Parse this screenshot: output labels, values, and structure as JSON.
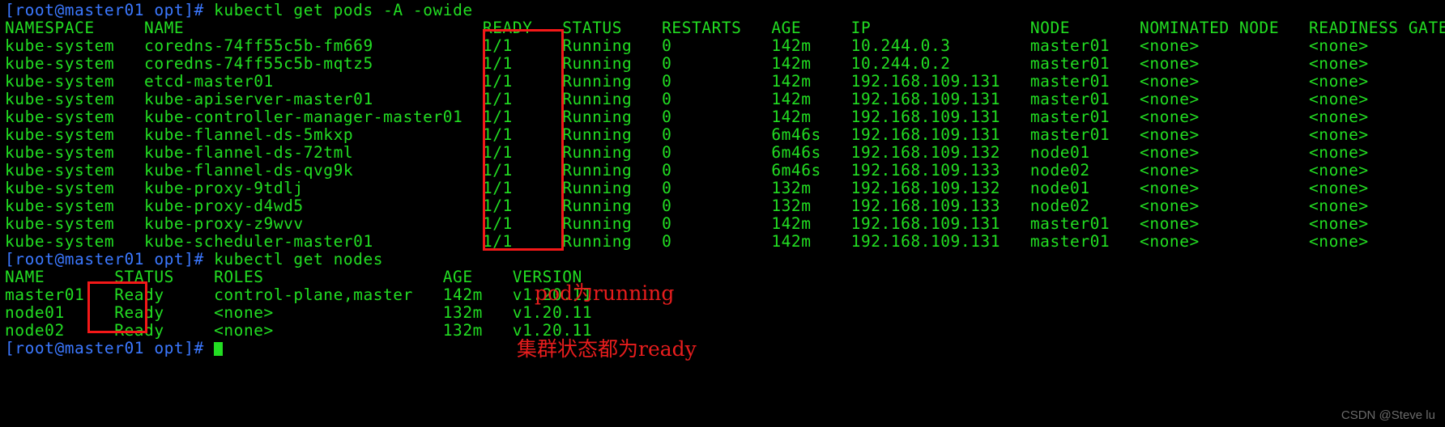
{
  "terminal": {
    "prompt": "[root@master01 opt]#",
    "commands": {
      "get_pods": "kubectl get pods -A -owide",
      "get_nodes": "kubectl get nodes"
    },
    "pods_table": {
      "headers": [
        "NAMESPACE",
        "NAME",
        "READY",
        "STATUS",
        "RESTARTS",
        "AGE",
        "IP",
        "NODE",
        "NOMINATED NODE",
        "READINESS GATES"
      ],
      "rows": [
        [
          "kube-system",
          "coredns-74ff55c5b-fm669",
          "1/1",
          "Running",
          "0",
          "142m",
          "10.244.0.3",
          "master01",
          "<none>",
          "<none>"
        ],
        [
          "kube-system",
          "coredns-74ff55c5b-mqtz5",
          "1/1",
          "Running",
          "0",
          "142m",
          "10.244.0.2",
          "master01",
          "<none>",
          "<none>"
        ],
        [
          "kube-system",
          "etcd-master01",
          "1/1",
          "Running",
          "0",
          "142m",
          "192.168.109.131",
          "master01",
          "<none>",
          "<none>"
        ],
        [
          "kube-system",
          "kube-apiserver-master01",
          "1/1",
          "Running",
          "0",
          "142m",
          "192.168.109.131",
          "master01",
          "<none>",
          "<none>"
        ],
        [
          "kube-system",
          "kube-controller-manager-master01",
          "1/1",
          "Running",
          "0",
          "142m",
          "192.168.109.131",
          "master01",
          "<none>",
          "<none>"
        ],
        [
          "kube-system",
          "kube-flannel-ds-5mkxp",
          "1/1",
          "Running",
          "0",
          "6m46s",
          "192.168.109.131",
          "master01",
          "<none>",
          "<none>"
        ],
        [
          "kube-system",
          "kube-flannel-ds-72tml",
          "1/1",
          "Running",
          "0",
          "6m46s",
          "192.168.109.132",
          "node01",
          "<none>",
          "<none>"
        ],
        [
          "kube-system",
          "kube-flannel-ds-qvg9k",
          "1/1",
          "Running",
          "0",
          "6m46s",
          "192.168.109.133",
          "node02",
          "<none>",
          "<none>"
        ],
        [
          "kube-system",
          "kube-proxy-9tdlj",
          "1/1",
          "Running",
          "0",
          "132m",
          "192.168.109.132",
          "node01",
          "<none>",
          "<none>"
        ],
        [
          "kube-system",
          "kube-proxy-d4wd5",
          "1/1",
          "Running",
          "0",
          "132m",
          "192.168.109.133",
          "node02",
          "<none>",
          "<none>"
        ],
        [
          "kube-system",
          "kube-proxy-z9wvv",
          "1/1",
          "Running",
          "0",
          "142m",
          "192.168.109.131",
          "master01",
          "<none>",
          "<none>"
        ],
        [
          "kube-system",
          "kube-scheduler-master01",
          "1/1",
          "Running",
          "0",
          "142m",
          "192.168.109.131",
          "master01",
          "<none>",
          "<none>"
        ]
      ]
    },
    "nodes_table": {
      "headers": [
        "NAME",
        "STATUS",
        "ROLES",
        "AGE",
        "VERSION"
      ],
      "rows": [
        [
          "master01",
          "Ready",
          "control-plane,master",
          "142m",
          "v1.20.11"
        ],
        [
          "node01",
          "Ready",
          "<none>",
          "132m",
          "v1.20.11"
        ],
        [
          "node02",
          "Ready",
          "<none>",
          "132m",
          "v1.20.11"
        ]
      ]
    },
    "rendered_lines": [
      "NAMESPACE     NAME                              READY   STATUS    RESTARTS   AGE     IP                NODE       NOMINATED NODE   READINESS GATES",
      "kube-system   coredns-74ff55c5b-fm669           1/1     Running   0          142m    10.244.0.3        master01   <none>           <none>",
      "kube-system   coredns-74ff55c5b-mqtz5           1/1     Running   0          142m    10.244.0.2        master01   <none>           <none>",
      "kube-system   etcd-master01                     1/1     Running   0          142m    192.168.109.131   master01   <none>           <none>",
      "kube-system   kube-apiserver-master01           1/1     Running   0          142m    192.168.109.131   master01   <none>           <none>",
      "kube-system   kube-controller-manager-master01  1/1     Running   0          142m    192.168.109.131   master01   <none>           <none>",
      "kube-system   kube-flannel-ds-5mkxp             1/1     Running   0          6m46s   192.168.109.131   master01   <none>           <none>",
      "kube-system   kube-flannel-ds-72tml             1/1     Running   0          6m46s   192.168.109.132   node01     <none>           <none>",
      "kube-system   kube-flannel-ds-qvg9k             1/1     Running   0          6m46s   192.168.109.133   node02     <none>           <none>",
      "kube-system   kube-proxy-9tdlj                  1/1     Running   0          132m    192.168.109.132   node01     <none>           <none>",
      "kube-system   kube-proxy-d4wd5                  1/1     Running   0          132m    192.168.109.133   node02     <none>           <none>",
      "kube-system   kube-proxy-z9wvv                  1/1     Running   0          142m    192.168.109.131   master01   <none>           <none>",
      "kube-system   kube-scheduler-master01           1/1     Running   0          142m    192.168.109.131   master01   <none>           <none>"
    ],
    "nodes_rendered_lines": [
      "NAME       STATUS    ROLES                  AGE    VERSION",
      "master01   Ready     control-plane,master   142m   v1.20.11",
      "node01     Ready     <none>                 132m   v1.20.11",
      "node02     Ready     <none>                 132m   v1.20.11"
    ]
  },
  "annotations": {
    "pod_running": "pod为running",
    "cluster_ready": "集群状态都为ready"
  },
  "watermark": "CSDN @Steve lu",
  "colors": {
    "background": "#000000",
    "terminal_green": "#22dd22",
    "prompt_blue": "#3b78ff",
    "highlight_red": "#f41818",
    "annotation_red": "#e81d1d",
    "watermark_gray": "#6a6a6a"
  }
}
